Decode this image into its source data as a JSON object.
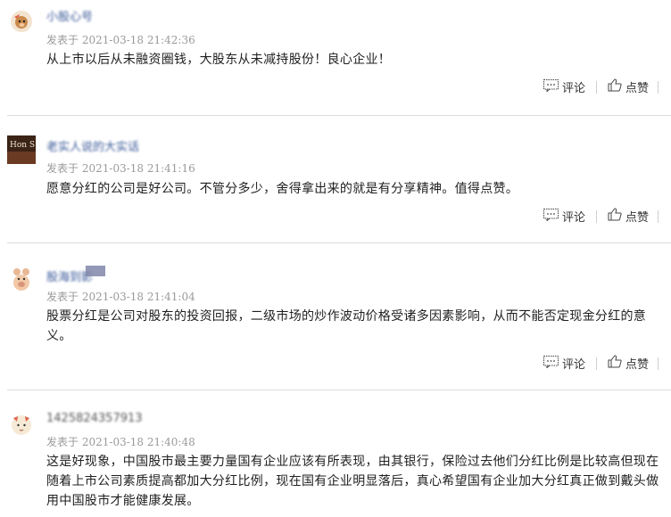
{
  "comments": [
    {
      "username": "小股心号",
      "time_prefix": "发表于",
      "time": "2021-03-18 21:42:36",
      "text": "从上市以后从未融资圈钱，大股东从未减持股份！良心企业！",
      "reply_label": "评论",
      "like_label": "点赞",
      "avatar_icon": "monkey-avatar-icon"
    },
    {
      "username": "老实人说的大实话",
      "time_prefix": "发表于",
      "time": "2021-03-18 21:41:16",
      "text": "愿意分红的公司是好公司。不管分多少，舍得拿出来的就是有分享精神。值得点赞。",
      "reply_label": "评论",
      "like_label": "点赞",
      "avatar_text": "Hon S",
      "avatar_icon": "photo-avatar-icon"
    },
    {
      "username": "股海到影",
      "time_prefix": "发表于",
      "time": "2021-03-18 21:41:04",
      "text": "股票分红是公司对股东的投资回报，二级市场的炒作波动价格受诸多因素影响，从而不能否定现金分红的意义。",
      "reply_label": "评论",
      "like_label": "点赞",
      "avatar_icon": "hippo-avatar-icon"
    },
    {
      "username": "1425824357913",
      "time_prefix": "发表于",
      "time": "2021-03-18 21:40:48",
      "text": "这是好现象，中国股市最主要力量国有企业应该有所表现，由其银行，保险过去他们分红比例是比较高但现在随着上市公司素质提高都加大分红比例，现在国有企业明显落后，真心希望国有企业加大分红真正做到戴头做用中国股市才能健康发展。",
      "reply_label": "评论",
      "like_label": "点赞",
      "avatar_icon": "cat-avatar-icon"
    }
  ],
  "colors": {
    "username": "#3b5a9a",
    "time": "#9a9a9a",
    "divider": "#dcdcdc"
  }
}
